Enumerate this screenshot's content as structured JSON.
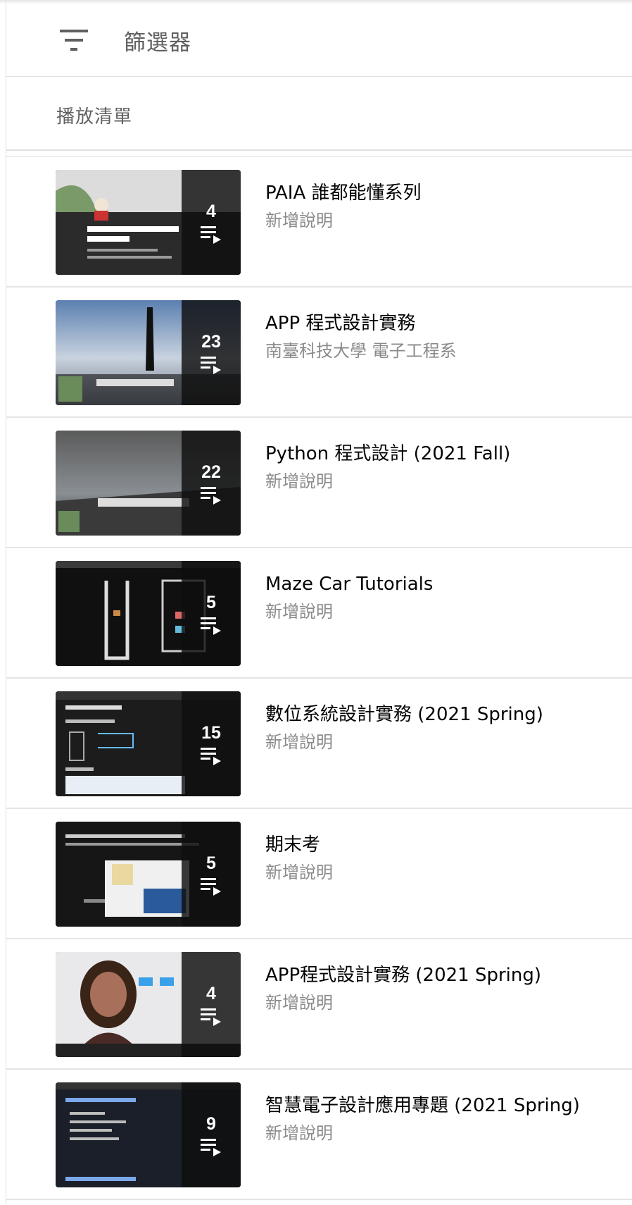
{
  "filter": {
    "label": "篩選器",
    "icon": "filter-icon"
  },
  "section": {
    "label": "播放清單"
  },
  "playlists": [
    {
      "title": "PAIA 誰都能懂系列",
      "description": "新增說明",
      "count": "4"
    },
    {
      "title": "APP 程式設計實務",
      "description": "南臺科技大學 電子工程系",
      "count": "23"
    },
    {
      "title": "Python 程式設計 (2021 Fall)",
      "description": "新增說明",
      "count": "22"
    },
    {
      "title": "Maze Car Tutorials",
      "description": "新增說明",
      "count": "5"
    },
    {
      "title": "數位系統設計實務 (2021 Spring)",
      "description": "新增說明",
      "count": "15"
    },
    {
      "title": "期末考",
      "description": "新增說明",
      "count": "5"
    },
    {
      "title": "APP程式設計實務 (2021 Spring)",
      "description": "新增說明",
      "count": "4"
    },
    {
      "title": "智慧電子設計應用專題 (2021 Spring)",
      "description": "新增說明",
      "count": "9"
    }
  ],
  "colors": {
    "title": "#030303",
    "secondary": "#606060",
    "description": "#8a8a8a",
    "divider": "#e0e0e0"
  }
}
